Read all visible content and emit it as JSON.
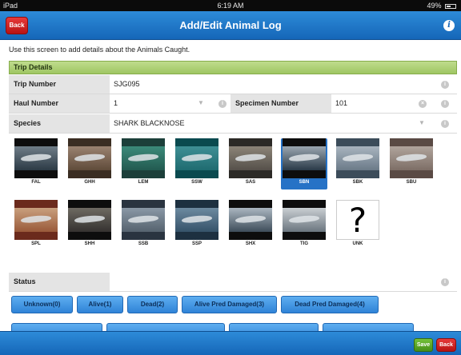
{
  "status_bar": {
    "device": "iPad",
    "time": "6:19 AM",
    "battery": "49%"
  },
  "header": {
    "title": "Add/Edit Animal Log",
    "back_label": "Back"
  },
  "instructions": "Use this screen to add details about the Animals Caught.",
  "trip_details": {
    "section_title": "Trip Details",
    "trip_number_label": "Trip Number",
    "trip_number_value": "SJG095",
    "haul_number_label": "Haul Number",
    "haul_number_value": "1",
    "specimen_number_label": "Specimen Number",
    "specimen_number_value": "101",
    "species_label": "Species",
    "species_value": "SHARK BLACKNOSE"
  },
  "species_grid": [
    {
      "code": "FAL",
      "selected": false
    },
    {
      "code": "GHH",
      "selected": false
    },
    {
      "code": "LEM",
      "selected": false
    },
    {
      "code": "SSW",
      "selected": false
    },
    {
      "code": "SAS",
      "selected": false
    },
    {
      "code": "SBN",
      "selected": true
    },
    {
      "code": "SBK",
      "selected": false
    },
    {
      "code": "SBU",
      "selected": false
    },
    {
      "code": "SPL",
      "selected": false
    },
    {
      "code": "SHH",
      "selected": false
    },
    {
      "code": "SSB",
      "selected": false
    },
    {
      "code": "SSP",
      "selected": false
    },
    {
      "code": "SHX",
      "selected": false
    },
    {
      "code": "TIG",
      "selected": false
    },
    {
      "code": "UNK",
      "selected": false
    }
  ],
  "status": {
    "label": "Status",
    "buttons": [
      "Unknown(0)",
      "Alive(1)",
      "Dead(2)",
      "Alive Pred Damaged(3)",
      "Dead Pred Damaged(4)"
    ]
  },
  "footer": {
    "save_label": "Save",
    "back_label": "Back"
  },
  "colors": {
    "nav_blue": "#1f78cc",
    "section_green": "#a9cd6e",
    "selected_blue": "#2672c6",
    "back_red": "#c91b1b",
    "save_green": "#5aa62a"
  }
}
